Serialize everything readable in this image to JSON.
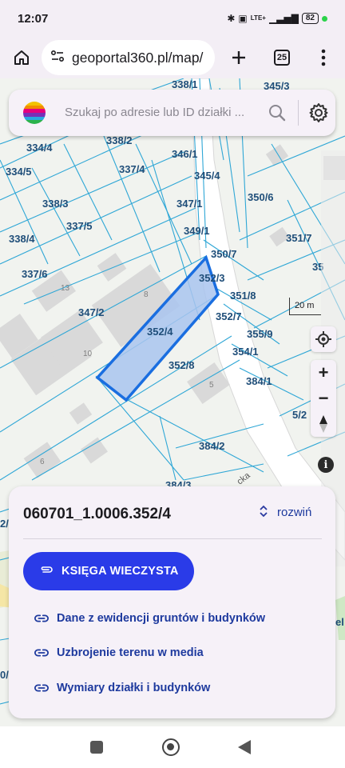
{
  "status": {
    "time": "12:07",
    "lte": "LTE+",
    "battery": "82"
  },
  "browser": {
    "url": "geoportal360.pl/map/",
    "tab_count": "25"
  },
  "search": {
    "placeholder": "Szukaj po adresie lub ID działki ..."
  },
  "map": {
    "scale_label": "20 m",
    "street_fragment": "cka",
    "plot_labels": [
      "338/1",
      "345/3",
      "338/2",
      "346/1",
      "334/4",
      "337/4",
      "345/4",
      "334/5",
      "347/1",
      "350/6",
      "338/3",
      "337/5",
      "349/1",
      "351/7",
      "338/4",
      "350/7",
      "337/6",
      "352/3",
      "35",
      "351/8",
      "347/2",
      "352/7",
      "355/9",
      "352/4",
      "354/1",
      "352/8",
      "384/1",
      "5/2",
      "384/2",
      "384/3",
      "2/",
      "0/",
      "el"
    ],
    "building_numbers": [
      "13",
      "8",
      "10",
      "5",
      "6"
    ]
  },
  "parcel": {
    "id": "060701_1.0006.352/4",
    "expand_label": "rozwiń",
    "kw_button": "KSIĘGA WIECZYSTA",
    "links": [
      "Dane z ewidencji gruntów i budynków",
      "Uzbrojenie terenu w media",
      "Wymiary działki i budynków"
    ]
  },
  "colors": {
    "accent": "#2a3be8",
    "link": "#1e3a9e",
    "parcel_line": "#2fa7d6",
    "selected_fill": "#a9c4ef",
    "selected_border": "#1a6ee0"
  },
  "icons": {
    "home": "home-icon",
    "tune": "site-settings-icon",
    "plus": "new-tab-icon",
    "tabs": "tabs-icon",
    "menu": "more-vert-icon",
    "search": "search-icon",
    "settings": "gear-icon",
    "locate": "locate-icon",
    "zoom_in": "zoom-in-icon",
    "zoom_out": "zoom-out-icon",
    "compass": "compass-icon",
    "info": "info-icon",
    "link": "link-icon",
    "attachment": "attachment-icon"
  }
}
